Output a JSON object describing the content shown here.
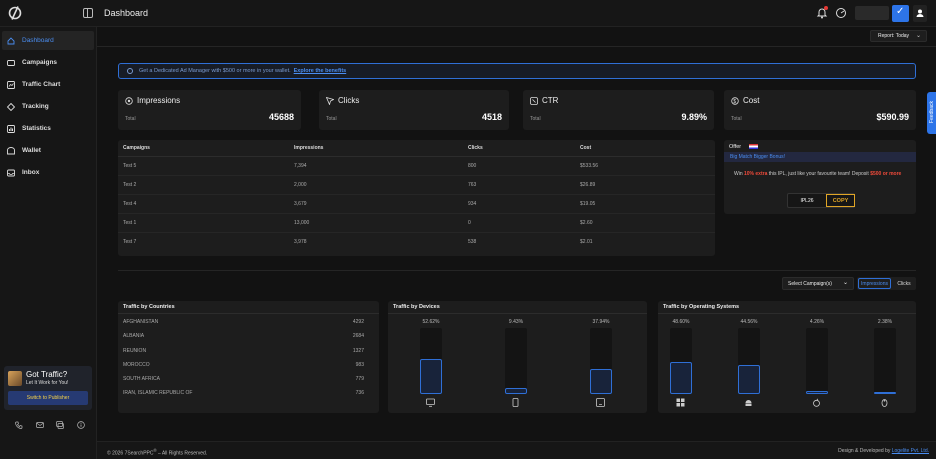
{
  "header": {
    "title": "Dashboard"
  },
  "sidebar": {
    "items": [
      {
        "label": "Dashboard",
        "icon": "home-icon"
      },
      {
        "label": "Campaigns",
        "icon": "campaigns-icon"
      },
      {
        "label": "Traffic Chart",
        "icon": "chart-icon"
      },
      {
        "label": "Tracking",
        "icon": "tracking-icon"
      },
      {
        "label": "Statistics",
        "icon": "statistics-icon"
      },
      {
        "label": "Wallet",
        "icon": "wallet-icon"
      },
      {
        "label": "Inbox",
        "icon": "inbox-icon"
      }
    ],
    "promo": {
      "title": "Got Traffic?",
      "subtitle": "Let It Work for You!",
      "button": "Switch to Publisher"
    }
  },
  "toolbar": {
    "report_label": "Report: Today"
  },
  "banner": {
    "text": "Get a Dedicated Ad Manager with $500 or more in your wallet.",
    "link": "Explore the benefits"
  },
  "stats": [
    {
      "title": "Impressions",
      "total_label": "Total",
      "value": "45688",
      "icon": "eye-icon"
    },
    {
      "title": "Clicks",
      "total_label": "Total",
      "value": "4518",
      "icon": "cursor-icon"
    },
    {
      "title": "CTR",
      "total_label": "Total",
      "value": "9.89%",
      "icon": "ctr-icon"
    },
    {
      "title": "Cost",
      "total_label": "Total",
      "value": "$590.99",
      "icon": "dollar-icon"
    }
  ],
  "campaign_table": {
    "headers": [
      "Campaigns",
      "Impressions",
      "Clicks",
      "Cost"
    ],
    "rows": [
      [
        "Test 5",
        "7,394",
        "800",
        "$533.56"
      ],
      [
        "Test 2",
        "2,000",
        "763",
        "$26.89"
      ],
      [
        "Test 4",
        "3,679",
        "934",
        "$19.05"
      ],
      [
        "Test 1",
        "13,000",
        "0",
        "$2.60"
      ],
      [
        "Test 7",
        "3,978",
        "538",
        "$2.01"
      ]
    ]
  },
  "offer": {
    "title": "Offer",
    "subtitle": "Big Match Bigger Bonus!",
    "text_before": "Win ",
    "text_highlight1": "10% extra",
    "text_middle": " this IPL, just like your favourite team! Deposit ",
    "text_highlight2": "$500 or more",
    "code": "IPL26",
    "copy_label": "COPY"
  },
  "filters": {
    "select_campaign": "Select Campaign(s)",
    "toggle_on": "Impressions",
    "toggle_off": "Clicks"
  },
  "countries": {
    "title": "Traffic by Countries",
    "rows": [
      {
        "name": "AFGHANISTAN",
        "value": "4292"
      },
      {
        "name": "ALBANIA",
        "value": "2684"
      },
      {
        "name": "REUNION",
        "value": "1327"
      },
      {
        "name": "MOROCCO",
        "value": "983"
      },
      {
        "name": "SOUTH AFRICA",
        "value": "779"
      },
      {
        "name": "IRAN, ISLAMIC REPUBLIC OF",
        "value": "736"
      }
    ]
  },
  "devices": {
    "title": "Traffic by Devices",
    "items": [
      {
        "pct": "52.62%",
        "value": 52.62,
        "icon": "desktop-icon"
      },
      {
        "pct": "9.43%",
        "value": 9.43,
        "icon": "mobile-icon"
      },
      {
        "pct": "37.94%",
        "value": 37.94,
        "icon": "tablet-icon"
      }
    ]
  },
  "os": {
    "title": "Traffic by Operating Systems",
    "items": [
      {
        "pct": "48.60%",
        "value": 48.6,
        "icon": "windows-icon"
      },
      {
        "pct": "44.56%",
        "value": 44.56,
        "icon": "android-icon"
      },
      {
        "pct": "4.26%",
        "value": 4.26,
        "icon": "apple-icon"
      },
      {
        "pct": "2.38%",
        "value": 2.38,
        "icon": "linux-icon"
      }
    ]
  },
  "footer": {
    "left": "© 2026 7SearchPPC",
    "left_suffix": " – All Rights Reserved.",
    "right": "Design & Developed by ",
    "right_link": "Logelite Pvt. Ltd."
  },
  "feedback": {
    "label": "Feedback"
  },
  "colors": {
    "accent": "#2d74e8",
    "link": "#4a8df0",
    "offer_red": "#ef4a3a",
    "copy_gold": "#e0a526"
  }
}
